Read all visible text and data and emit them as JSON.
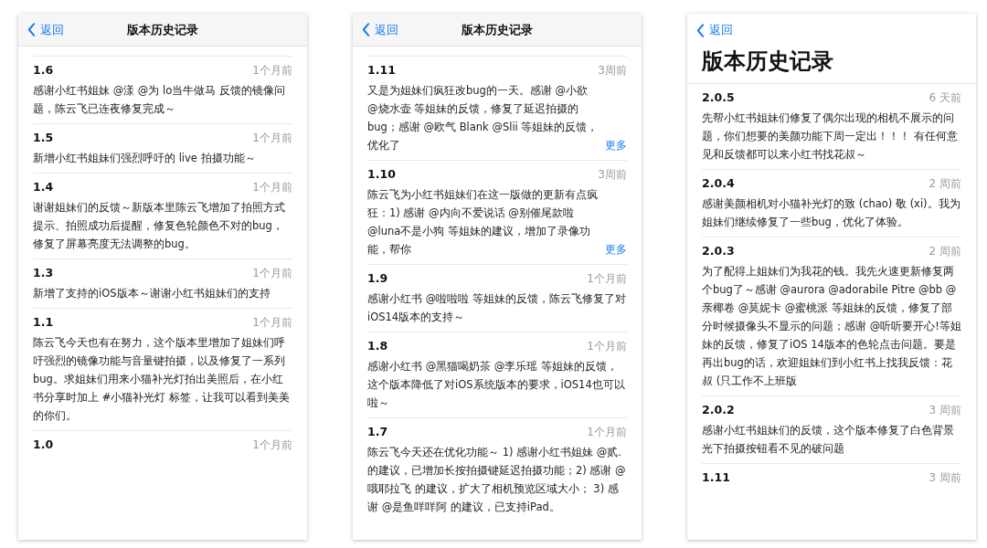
{
  "screens": [
    {
      "back": "返回",
      "title": "版本历史记录",
      "large_title": false,
      "entries": [
        {
          "version": "1.6",
          "time": "1个月前",
          "text": "感谢小红书姐妹 @漾 @为 lo当牛做马 反馈的镜像问题，陈云飞已连夜修复完成～"
        },
        {
          "version": "1.5",
          "time": "1个月前",
          "text": "新增小红书姐妹们强烈呼吁的 live 拍摄功能～"
        },
        {
          "version": "1.4",
          "time": "1个月前",
          "text": "谢谢姐妹们的反馈～新版本里陈云飞增加了拍照方式提示、拍照成功后提醒，修复色轮颜色不对的bug，修复了屏幕亮度无法调整的bug。"
        },
        {
          "version": "1.3",
          "time": "1个月前",
          "text": "新增了支持的iOS版本～谢谢小红书姐妹们的支持"
        },
        {
          "version": "1.1",
          "time": "1个月前",
          "text": "陈云飞今天也有在努力，这个版本里增加了姐妹们呼吁强烈的镜像功能与音量键拍摄，以及修复了一系列bug。求姐妹们用来小猫补光灯拍出美照后，在小红书分享时加上 #小猫补光灯 标签，让我可以看到美美的你们。"
        },
        {
          "version": "1.0",
          "time": "1个月前"
        }
      ]
    },
    {
      "back": "返回",
      "title": "版本历史记录",
      "large_title": false,
      "entries": [
        {
          "version": "1.11",
          "time": "3周前",
          "text": "又是为姐妹们疯狂改bug的一天。感谢 @小欲 @烧水壶 等姐妹的反馈，修复了延迟拍摄的bug；感谢 @欧气 Blank @Slii 等姐妹的反馈，优化了",
          "more": "更多"
        },
        {
          "version": "1.10",
          "time": "3周前",
          "text": "陈云飞为小红书姐妹们在这一版做的更新有点疯狂：1) 感谢 @内向不爱说话 @别催尾款啦 @luna不是小狗 等姐妹的建议，增加了录像功能，帮你",
          "more": "更多"
        },
        {
          "version": "1.9",
          "time": "1个月前",
          "text": "感谢小红书 @啦啦啦 等姐妹的反馈，陈云飞修复了对iOS14版本的支持～"
        },
        {
          "version": "1.8",
          "time": "1个月前",
          "text": "感谢小红书 @黑猫喝奶茶 @李乐瑶 等姐妹的反馈，这个版本降低了对iOS系统版本的要求，iOS14也可以啦～"
        },
        {
          "version": "1.7",
          "time": "1个月前",
          "text": "陈云飞今天还在优化功能～ 1) 感谢小红书姐妹 @贰. 的建议，已增加长按拍摄键延迟拍摄功能；2) 感谢 @哦耶拉飞 的建议，扩大了相机预览区域大小； 3) 感谢 @是鱼咩咩阿 的建议，已支持iPad。"
        }
      ]
    },
    {
      "back": "返回",
      "title": "版本历史记录",
      "large_title": true,
      "entries": [
        {
          "version": "2.0.5",
          "time": "6 天前",
          "text": "先帮小红书姐妹们修复了偶尔出现的相机不展示的问题，你们想要的美颜功能下周一定出！！！ 有任何意见和反馈都可以来小红书找花叔～"
        },
        {
          "version": "2.0.4",
          "time": "2 周前",
          "text": "感谢美颜相机对小猫补光灯的致 (chao) 敬 (xi)。我为姐妹们继续修复了一些bug，优化了体验。"
        },
        {
          "version": "2.0.3",
          "time": "2 周前",
          "text": "为了配得上姐妹们为我花的钱。我先火速更新修复两个bug了～感谢 @aurora @adorabile Pitre @bb @亲椰卷 @莫妮卡 @蜜桃派 等姐妹的反馈，修复了部分时候摄像头不显示的问题；感谢 @听听要开心!等姐妹的反馈，修复了iOS 14版本的色轮点击问题。要是再出bug的话，欢迎姐妹们到小红书上找我反馈：花叔 (只工作不上班版"
        },
        {
          "version": "2.0.2",
          "time": "3 周前",
          "text": "感谢小红书姐妹们的反馈，这个版本修复了白色背景光下拍摄按钮看不见的破问题"
        },
        {
          "version": "1.11",
          "time": "3 周前"
        }
      ]
    }
  ]
}
